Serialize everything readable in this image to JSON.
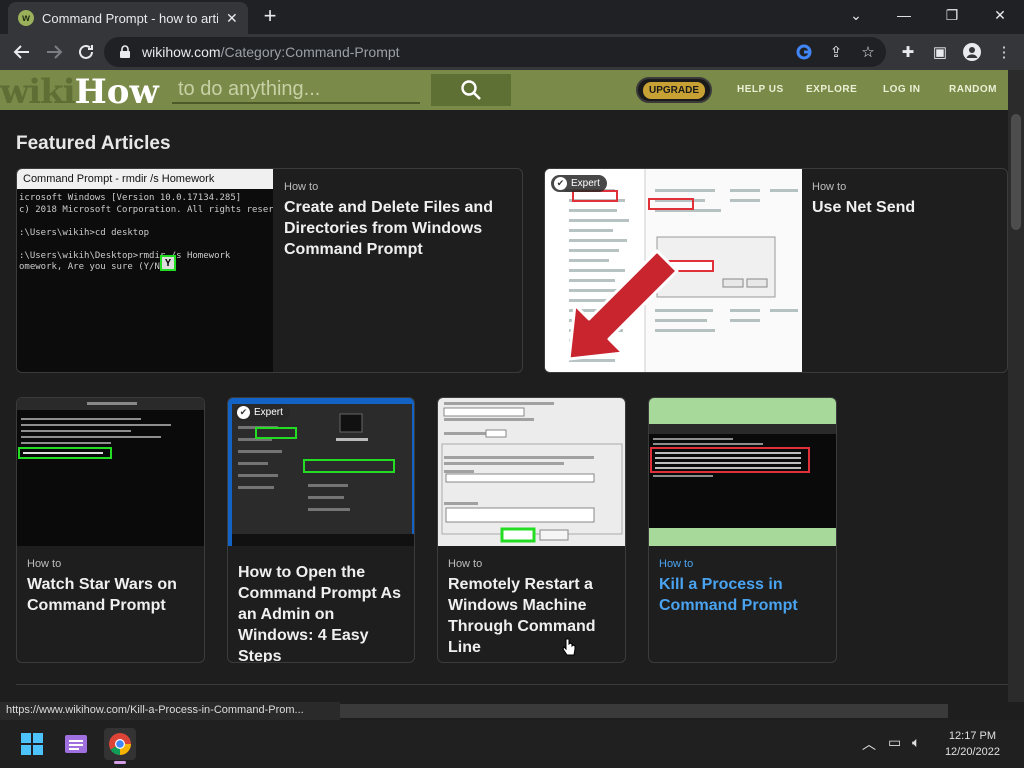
{
  "browser": {
    "tab_title": "Command Prompt - how to artic",
    "favicon_letter": "w",
    "url_host": "wikihow.com",
    "url_path": "/Category:Command-Prompt",
    "status_url": "https://www.wikihow.com/Kill-a-Process-in-Command-Prom..."
  },
  "header": {
    "logo_wiki": "wiki",
    "logo_how": "How",
    "search_placeholder": "to do anything...",
    "upgrade_label": "UPGRADE",
    "nav": [
      "HELP US",
      "EXPLORE",
      "LOG IN",
      "RANDOM"
    ]
  },
  "section_title": "Featured Articles",
  "howto_label": "How to",
  "expert_label": "Expert",
  "articles_large": [
    {
      "title": "Create and Delete Files and Directories from Windows Command Prompt",
      "cmd_bar": "Command Prompt - rmdir /s Homework",
      "cmd_lines": "icrosoft Windows [Version 10.0.17134.285]\nc) 2018 Microsoft Corporation. All rights reserved.\n\n:\\Users\\wikih>cd desktop\n\n:\\Users\\wikih\\Desktop>rmdir /s Homework\nomework, Are you sure (Y/N)?",
      "cmd_answer": "Y"
    },
    {
      "title": "Use Net Send"
    }
  ],
  "articles_small": [
    {
      "title": "Watch Star Wars on Command Prompt"
    },
    {
      "title": "How to Open the Command Prompt As an Admin on Windows: 4 Easy Steps"
    },
    {
      "title": "Remotely Restart a Windows Machine Through Command Line"
    },
    {
      "title": "Kill a Process in Command Prompt"
    }
  ],
  "taskbar": {
    "time": "12:17 PM",
    "date": "12/20/2022"
  },
  "colors": {
    "wikihow_green": "#7a8a48",
    "link_blue": "#4aa3f0",
    "highlight_green": "#22dd22",
    "highlight_red": "#e0303a"
  }
}
